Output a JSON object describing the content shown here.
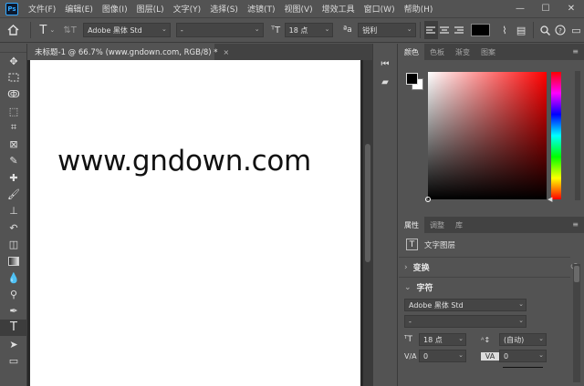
{
  "menubar": {
    "logo": "Ps",
    "items": [
      "文件(F)",
      "编辑(E)",
      "图像(I)",
      "图层(L)",
      "文字(Y)",
      "选择(S)",
      "滤镜(T)",
      "视图(V)",
      "增效工具",
      "窗口(W)",
      "帮助(H)"
    ],
    "window_controls": [
      "—",
      "☐",
      "✕"
    ]
  },
  "options": {
    "font_family": "Adobe 黑体 Std",
    "font_style": "-",
    "font_size": "18 点",
    "antialias": "锐利"
  },
  "tab": {
    "title": "未标题-1 @ 66.7% (www.gndown.com, RGB/8) *",
    "close": "×"
  },
  "canvas": {
    "text": "www.gndown.com"
  },
  "color_panel": {
    "tabs": [
      "颜色",
      "色板",
      "渐变",
      "图案"
    ]
  },
  "properties_panel": {
    "tabs": [
      "属性",
      "调整",
      "库"
    ],
    "layer_type": "文字图层",
    "transform_label": "变换",
    "character_label": "字符",
    "font_family": "Adobe 黑体 Std",
    "font_style": "-",
    "font_size": "18 点",
    "leading": "(自动)",
    "kerning": "0",
    "tracking": "0"
  }
}
